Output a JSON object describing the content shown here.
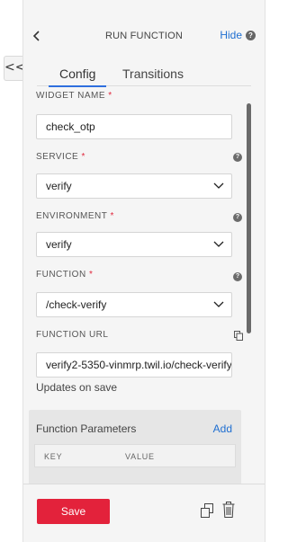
{
  "panel": {
    "collapse_glyph": "<<",
    "header": {
      "title": "RUN FUNCTION",
      "hide_label": "Hide",
      "help_glyph": "?"
    },
    "tabs": [
      {
        "label": "Config",
        "active": true
      },
      {
        "label": "Transitions",
        "active": false
      }
    ],
    "fields": {
      "widget_name": {
        "label": "WIDGET NAME",
        "required": "*",
        "value": "check_otp"
      },
      "service": {
        "label": "SERVICE",
        "required": "*",
        "value": "verify"
      },
      "environment": {
        "label": "ENVIRONMENT",
        "required": "*",
        "value": "verify"
      },
      "function": {
        "label": "FUNCTION",
        "required": "*",
        "value": "/check-verify"
      },
      "function_url": {
        "label": "FUNCTION URL",
        "value": "verify2-5350-vinmrp.twil.io/check-verify",
        "note": "Updates on save"
      }
    },
    "parameters": {
      "title": "Function Parameters",
      "add_label": "Add",
      "columns": [
        "KEY",
        "VALUE"
      ]
    },
    "footer": {
      "save_label": "Save"
    }
  },
  "colors": {
    "accent_link": "#1f6fd1",
    "tab_underline": "#2f6fde",
    "save_button": "#e3223b",
    "required_star": "#e0283d"
  },
  "icons": [
    "back-chevron-icon",
    "help-icon",
    "chevron-down-icon",
    "copy-icon",
    "duplicate-icon",
    "trash-icon"
  ]
}
